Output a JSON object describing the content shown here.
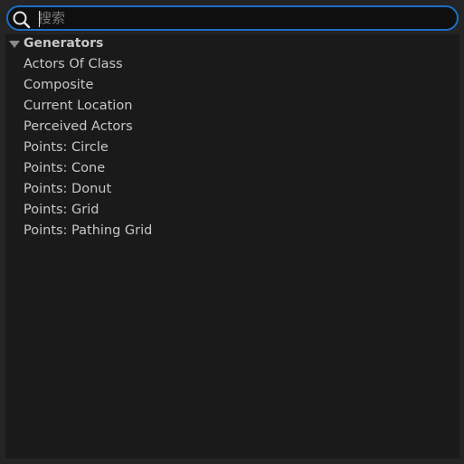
{
  "search": {
    "placeholder": "搜索",
    "value": ""
  },
  "category": {
    "label": "Generators",
    "expanded": true
  },
  "items": [
    {
      "label": "Actors Of Class"
    },
    {
      "label": "Composite"
    },
    {
      "label": "Current Location"
    },
    {
      "label": "Perceived Actors"
    },
    {
      "label": "Points: Circle"
    },
    {
      "label": "Points: Cone"
    },
    {
      "label": "Points: Donut"
    },
    {
      "label": "Points: Grid"
    },
    {
      "label": "Points: Pathing Grid"
    }
  ],
  "colors": {
    "accent": "#1b6fc4",
    "panel": "#1a1a1a",
    "background": "#242424",
    "text": "#c8c8c8"
  },
  "icons": {
    "search": "search-icon",
    "expand": "triangle-down-icon"
  }
}
